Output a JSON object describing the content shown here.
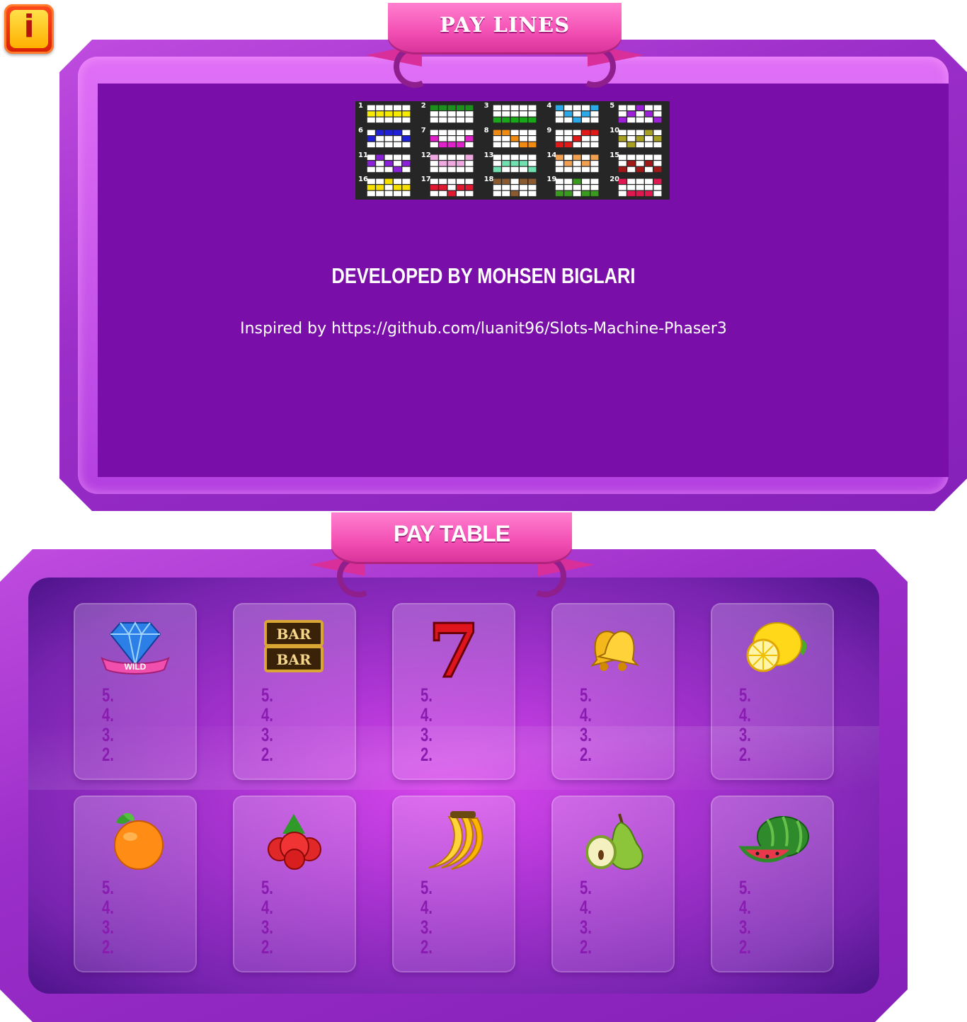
{
  "info_button": {
    "glyph": "i"
  },
  "paylines_section": {
    "title": "PAY LINES",
    "lines": [
      {
        "num": "1",
        "color": "#f5ea00",
        "pattern": [
          1,
          1,
          1,
          1,
          1
        ]
      },
      {
        "num": "2",
        "color": "#1c8f1c",
        "pattern": [
          0,
          0,
          0,
          0,
          0
        ]
      },
      {
        "num": "3",
        "color": "#18a818",
        "pattern": [
          2,
          2,
          2,
          2,
          2
        ]
      },
      {
        "num": "4",
        "color": "#2aa8e8",
        "pattern": [
          0,
          1,
          2,
          1,
          0
        ]
      },
      {
        "num": "5",
        "color": "#9b20d8",
        "pattern": [
          2,
          1,
          0,
          1,
          2
        ]
      },
      {
        "num": "6",
        "color": "#2020d8",
        "pattern": [
          1,
          0,
          0,
          0,
          1
        ]
      },
      {
        "num": "7",
        "color": "#e020c8",
        "pattern": [
          1,
          2,
          2,
          2,
          1
        ]
      },
      {
        "num": "8",
        "color": "#f08a10",
        "pattern": [
          0,
          0,
          1,
          2,
          2
        ]
      },
      {
        "num": "9",
        "color": "#e01818",
        "pattern": [
          2,
          2,
          1,
          0,
          0
        ]
      },
      {
        "num": "10",
        "color": "#a8a020",
        "pattern": [
          1,
          2,
          1,
          0,
          1
        ]
      },
      {
        "num": "11",
        "color": "#8a20d8",
        "pattern": [
          1,
          0,
          1,
          2,
          1
        ]
      },
      {
        "num": "12",
        "color": "#f0a8e0",
        "pattern": [
          0,
          1,
          1,
          1,
          0
        ]
      },
      {
        "num": "13",
        "color": "#70e0b0",
        "pattern": [
          2,
          1,
          1,
          1,
          2
        ]
      },
      {
        "num": "14",
        "color": "#f0a050",
        "pattern": [
          0,
          1,
          0,
          1,
          0
        ]
      },
      {
        "num": "15",
        "color": "#a01818",
        "pattern": [
          2,
          1,
          2,
          1,
          2
        ]
      },
      {
        "num": "16",
        "color": "#f5e000",
        "pattern": [
          1,
          1,
          0,
          1,
          1
        ]
      },
      {
        "num": "17",
        "color": "#e01830",
        "pattern": [
          1,
          1,
          2,
          1,
          1
        ]
      },
      {
        "num": "18",
        "color": "#8a5a30",
        "pattern": [
          0,
          0,
          2,
          0,
          0
        ]
      },
      {
        "num": "19",
        "color": "#3a9a20",
        "pattern": [
          2,
          2,
          0,
          2,
          2
        ]
      },
      {
        "num": "20",
        "color": "#e01850",
        "pattern": [
          0,
          2,
          2,
          2,
          0
        ]
      }
    ],
    "developer": "DEVELOPED BY MOHSEN BIGLARI",
    "inspired": "Inspired by https://github.com/luanit96/Slots-Machine-Phaser3"
  },
  "paytable_section": {
    "title": "PAY TABLE",
    "symbols": [
      {
        "name": "diamond-wild",
        "label": "WILD",
        "pays": [
          "5.",
          "4.",
          "3.",
          "2."
        ]
      },
      {
        "name": "bar",
        "label": "BAR",
        "pays": [
          "5.",
          "4.",
          "3.",
          "2."
        ]
      },
      {
        "name": "seven",
        "label": "7",
        "pays": [
          "5.",
          "4.",
          "3.",
          "2."
        ]
      },
      {
        "name": "bells",
        "pays": [
          "5.",
          "4.",
          "3.",
          "2."
        ]
      },
      {
        "name": "lemon",
        "pays": [
          "5.",
          "4.",
          "3.",
          "2."
        ]
      },
      {
        "name": "orange",
        "pays": [
          "5.",
          "4.",
          "3.",
          "2."
        ]
      },
      {
        "name": "strawberries",
        "pays": [
          "5.",
          "4.",
          "3.",
          "2."
        ]
      },
      {
        "name": "bananas",
        "pays": [
          "5.",
          "4.",
          "3.",
          "2."
        ]
      },
      {
        "name": "pear",
        "pays": [
          "5.",
          "4.",
          "3.",
          "2."
        ]
      },
      {
        "name": "watermelon",
        "pays": [
          "5.",
          "4.",
          "3.",
          "2."
        ]
      }
    ]
  }
}
